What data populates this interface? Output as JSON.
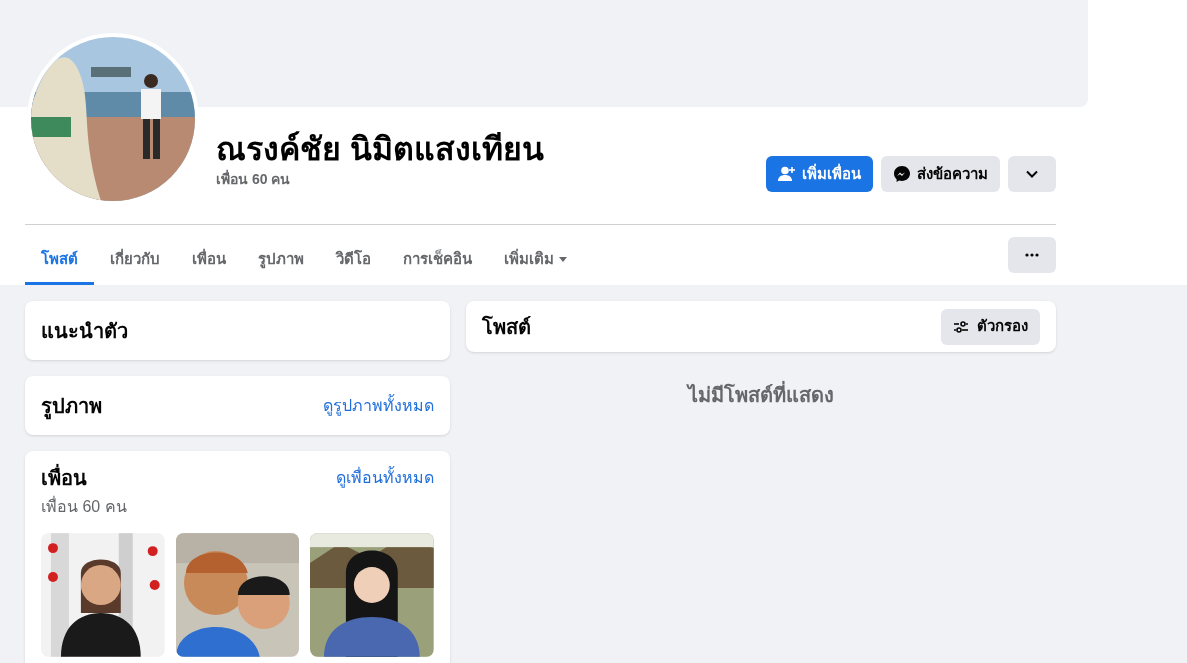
{
  "profile": {
    "name": "ณรงค์ชัย นิมิตแสงเทียน",
    "friend_count": "เพื่อน 60 คน"
  },
  "actions": [
    {
      "kind": "add_friend",
      "label": "เพิ่มเพื่อน"
    },
    {
      "kind": "message",
      "label": "ส่งข้อความ"
    },
    {
      "kind": "menu"
    }
  ],
  "tabs": [
    {
      "label": "โพสต์",
      "selected": true
    },
    {
      "label": "เกี่ยวกับ",
      "selected": false
    },
    {
      "label": "เพื่อน",
      "selected": false
    },
    {
      "label": "รูปภาพ",
      "selected": false
    },
    {
      "label": "วิดีโอ",
      "selected": false
    },
    {
      "label": "การเช็คอิน",
      "selected": false
    },
    {
      "label": "เพิ่มเติม",
      "selected": false,
      "dropdown": true
    }
  ],
  "intro": {
    "title": "แนะนำตัว"
  },
  "photos": {
    "title": "รูปภาพ",
    "link": "ดูรูปภาพทั้งหมด"
  },
  "friends": {
    "title": "เพื่อน",
    "link": "ดูเพื่อนทั้งหมด",
    "count": "เพื่อน 60 คน"
  },
  "posts": {
    "title": "โพสต์",
    "filter": "ตัวกรอง",
    "empty": "ไม่มีโพสต์ที่แสดง"
  }
}
